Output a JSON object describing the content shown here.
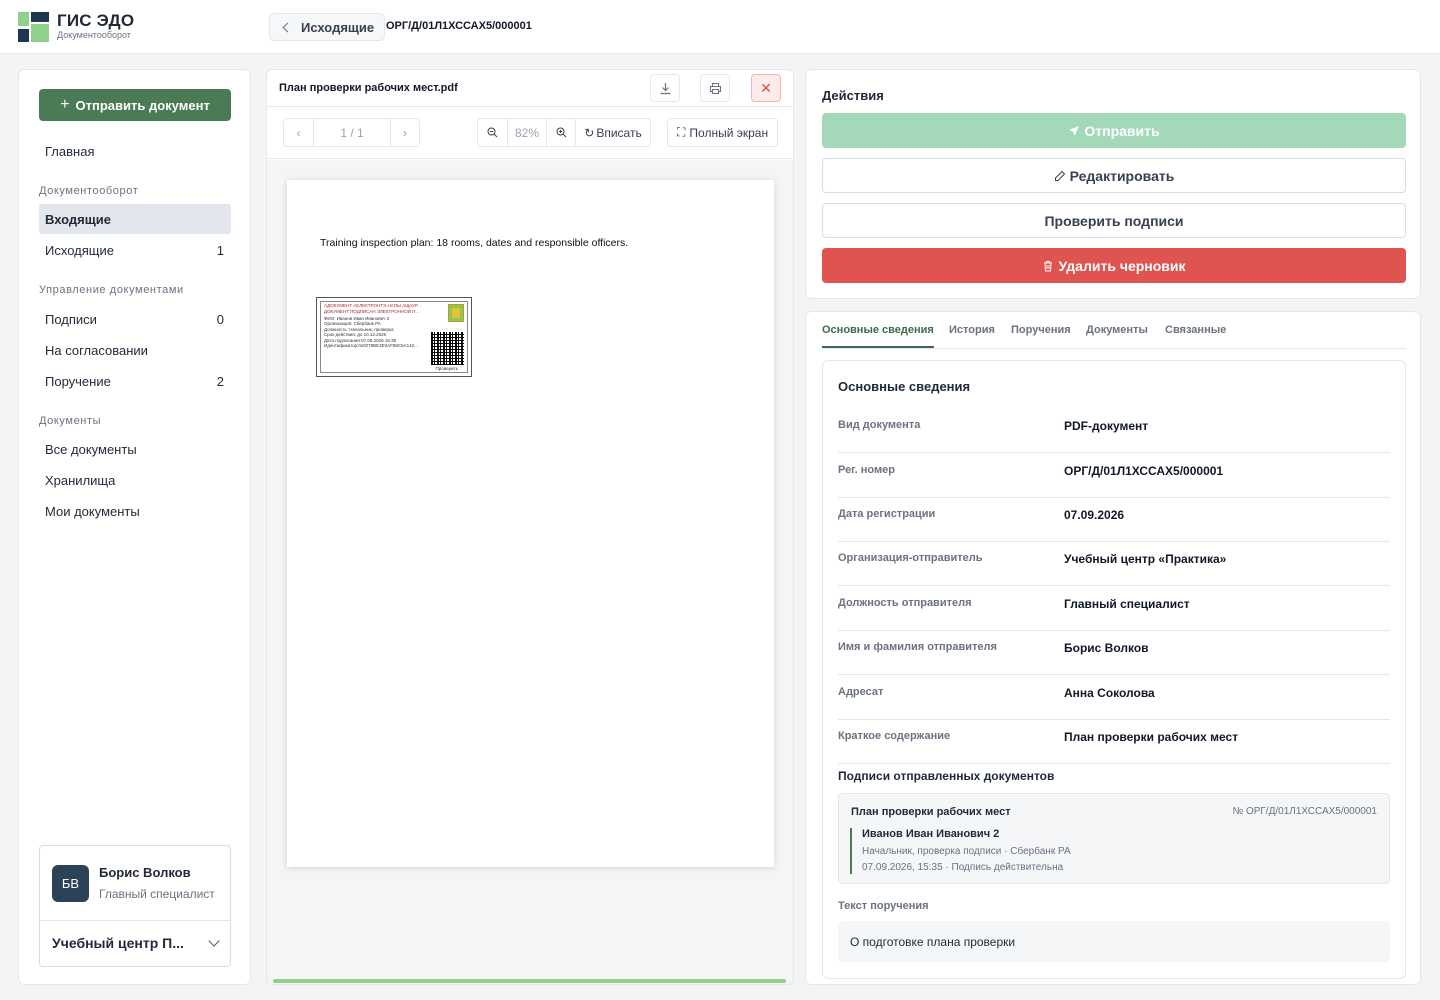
{
  "header": {
    "brand_title": "ГИС ЭДО",
    "brand_subtitle": "Документооборот",
    "back_label": "Исходящие",
    "doc_id": "ОРГ/Д/01Л1ХССАХ5/000001"
  },
  "sidebar": {
    "send_button": "Отправить документ",
    "home": "Главная",
    "sections": [
      {
        "title": "Документооборот",
        "items": [
          {
            "label": "Входящие",
            "count": ""
          },
          {
            "label": "Исходящие",
            "count": "1"
          }
        ]
      },
      {
        "title": "Управление документами",
        "items": [
          {
            "label": "Подписи",
            "count": "0"
          },
          {
            "label": "На согласовании",
            "count": ""
          },
          {
            "label": "Поручение",
            "count": "2"
          }
        ]
      },
      {
        "title": "Документы",
        "items": [
          {
            "label": "Все документы",
            "count": ""
          },
          {
            "label": "Хранилища",
            "count": ""
          },
          {
            "label": "Мои документы",
            "count": ""
          }
        ]
      }
    ],
    "user": {
      "initials": "БВ",
      "name": "Борис Волков",
      "role": "Главный специалист",
      "org": "Учебный центр П..."
    }
  },
  "viewer": {
    "file_name": "План проверки рабочих мест.pdf",
    "page_indicator": "1 / 1",
    "zoom": "82%",
    "fit_label": "Вписать",
    "fullscreen_label": "Полный экран",
    "page_text": "Training inspection plan: 18 rooms, dates and responsible officers.",
    "stamp": {
      "header_lines": [
        "АДОКУМЕНТ АЕЛЕКТРОНТЭ НАПЫ АЩАУР...",
        "ДОКУМЕНТ ПОДПИСАН ЭЛЕКТРОННОЙ П..."
      ],
      "lines": [
        "ФИО:            Иванов Иван Иванович 2",
        "Организация:    Сбербанк РА",
        "Должность:      Начальник, проверка",
        "Срок действия:  до 10.12.2026",
        "Дата подписания:07.09.2026 15:35",
        "Идентификатор:0x0279BE3E0AF89C5A142..."
      ],
      "verify_label": "Проверить"
    }
  },
  "actions": {
    "title": "Действия",
    "send": "Отправить",
    "edit": "Редактировать",
    "verify": "Проверить подписи",
    "delete": "Удалить черновик"
  },
  "tabs": [
    "Основные сведения",
    "История",
    "Поручения",
    "Документы",
    "Связанные"
  ],
  "details": {
    "title": "Основные сведения",
    "rows": [
      {
        "label": "Вид документа",
        "value": "PDF-документ"
      },
      {
        "label": "Рег. номер",
        "value": "ОРГ/Д/01Л1ХССАХ5/000001"
      },
      {
        "label": "Дата регистрации",
        "value": "07.09.2026"
      },
      {
        "label": "Организация-отправитель",
        "value": "Учебный центр «Практика»"
      },
      {
        "label": "Должность отправителя",
        "value": "Главный специалист"
      },
      {
        "label": "Имя и фамилия отправителя",
        "value": "Борис Волков"
      },
      {
        "label": "Адресат",
        "value": "Анна Соколова"
      },
      {
        "label": "Краткое содержание",
        "value": "План проверки рабочих мест"
      }
    ],
    "signatures_title": "Подписи отправленных документов",
    "signature": {
      "doc_name": "План проверки рабочих мест",
      "doc_number": "№ ОРГ/Д/01Л1ХССАХ5/000001",
      "signer": "Иванов Иван Иванович 2",
      "role_org": "Начальник, проверка подписи · Сбербанк РА",
      "status": "07.09.2026, 15:35 · Подпись действительна"
    },
    "task_title": "Текст поручения",
    "task_text": "О подготовке плана проверки"
  }
}
